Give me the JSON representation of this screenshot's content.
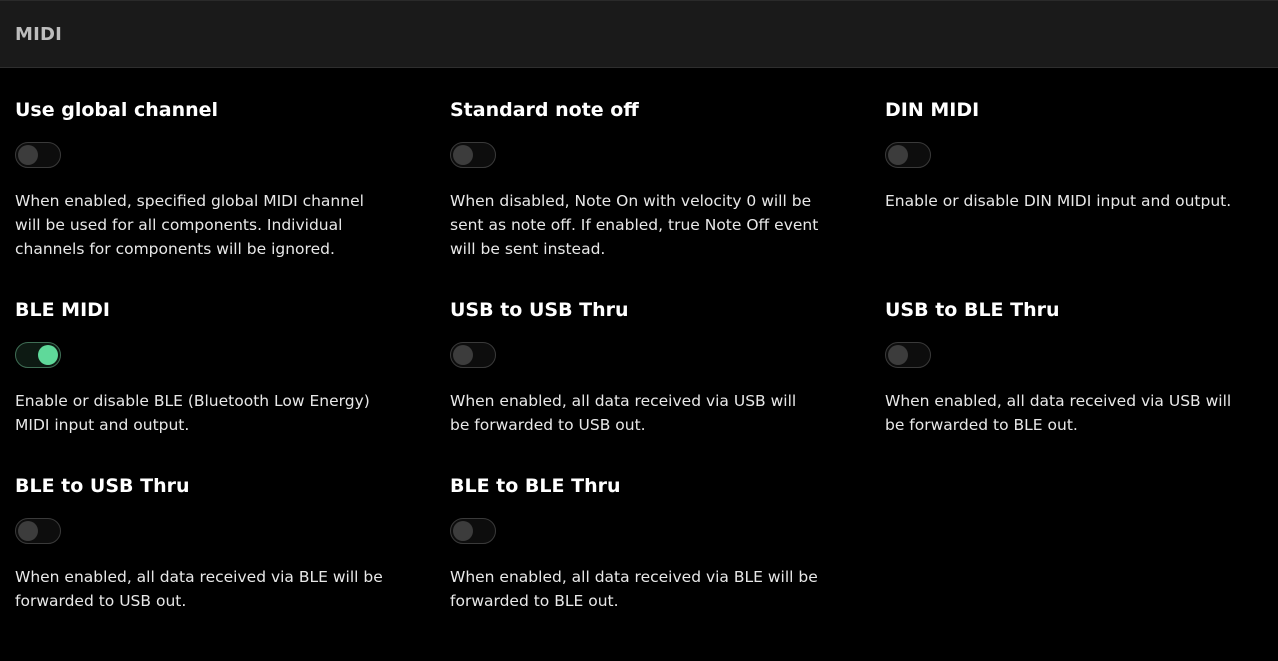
{
  "header": {
    "title": "MIDI"
  },
  "settings": [
    {
      "id": "use-global-channel",
      "title": "Use global channel",
      "enabled": false,
      "description": "When enabled, specified global MIDI channel will be used for all components. Individual channels for components will be ignored."
    },
    {
      "id": "standard-note-off",
      "title": "Standard note off",
      "enabled": false,
      "description": "When disabled, Note On with velocity 0 will be sent as note off. If enabled, true Note Off event will be sent instead."
    },
    {
      "id": "din-midi",
      "title": "DIN MIDI",
      "enabled": false,
      "description": "Enable or disable DIN MIDI input and output."
    },
    {
      "id": "ble-midi",
      "title": "BLE MIDI",
      "enabled": true,
      "description": "Enable or disable BLE (Bluetooth Low Energy) MIDI input and output."
    },
    {
      "id": "usb-to-usb-thru",
      "title": "USB to USB Thru",
      "enabled": false,
      "description": "When enabled, all data received via USB will be forwarded to USB out."
    },
    {
      "id": "usb-to-ble-thru",
      "title": "USB to BLE Thru",
      "enabled": false,
      "description": "When enabled, all data received via USB will be forwarded to BLE out."
    },
    {
      "id": "ble-to-usb-thru",
      "title": "BLE to USB Thru",
      "enabled": false,
      "description": "When enabled, all data received via BLE will be forwarded to USB out."
    },
    {
      "id": "ble-to-ble-thru",
      "title": "BLE to BLE Thru",
      "enabled": false,
      "description": "When enabled, all data received via BLE will be forwarded to BLE out."
    }
  ],
  "colors": {
    "toggle_on": "#5fd99a",
    "toggle_off": "#3c3c3c"
  }
}
